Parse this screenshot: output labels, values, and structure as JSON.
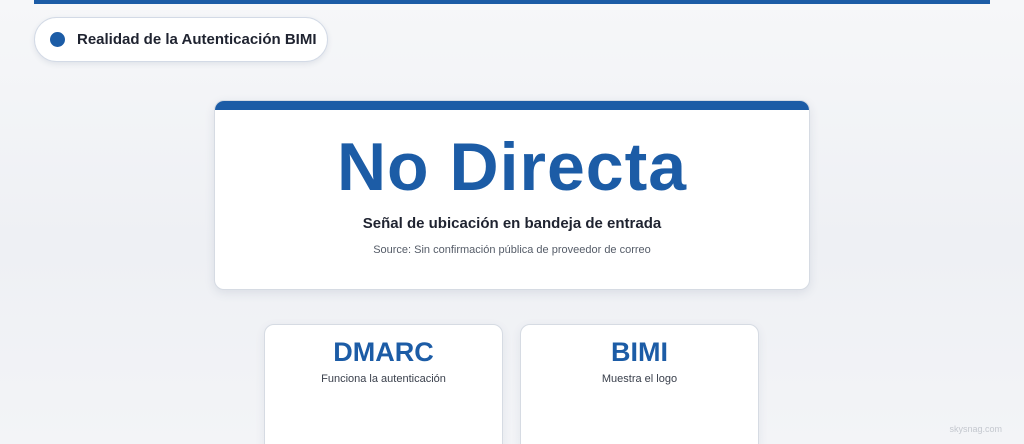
{
  "header": {
    "pill_label": "Realidad de la Autenticación BIMI"
  },
  "hero": {
    "value": "No Directa",
    "subtitle": "Señal de ubicación en bandeja de entrada",
    "source": "Source: Sin confirmación pública de proveedor de correo"
  },
  "cards": [
    {
      "title": "DMARC",
      "description": "Funciona la autenticación"
    },
    {
      "title": "BIMI",
      "description": "Muestra el logo"
    }
  ],
  "watermark": "skysnag.com",
  "colors": {
    "accent": "#1c5ca6",
    "text": "#1f2330",
    "card_border": "#d6dbe3"
  }
}
